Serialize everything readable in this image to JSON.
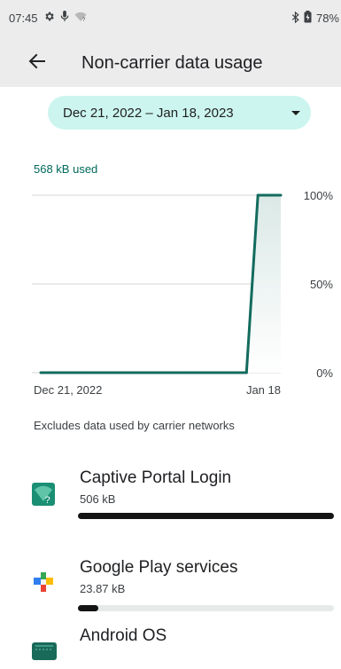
{
  "status_bar": {
    "time": "07:45",
    "battery": "78%",
    "icons": [
      "gear-icon",
      "mic-icon",
      "wifi-unknown-icon",
      "bluetooth-icon",
      "battery-charging-icon"
    ]
  },
  "app_bar": {
    "title": "Non-carrier data usage",
    "back_icon": "arrow-left-icon"
  },
  "date_range": {
    "label": "Dec 21, 2022 – Jan 18, 2023",
    "dropdown_icon": "caret-down-icon"
  },
  "usage": {
    "summary": "568 kB used"
  },
  "chart_data": {
    "type": "line",
    "x_start_label": "Dec 21, 2022",
    "x_end_label": "Jan 18",
    "y_ticks": [
      "100%",
      "50%",
      "0%"
    ],
    "ylim": [
      0,
      100
    ],
    "y_unit": "%",
    "series": [
      {
        "values": [
          0,
          0,
          0,
          0,
          0,
          0,
          0,
          0,
          0,
          0,
          0,
          0,
          0,
          0,
          0,
          0,
          0,
          0,
          0,
          100,
          100,
          100
        ]
      }
    ],
    "colors": {
      "line": "#126b5e",
      "fill": "#dbe9e6",
      "grid": "#d6d6d6"
    }
  },
  "note": "Excludes data used by carrier networks",
  "apps": [
    {
      "name": "Captive Portal Login",
      "size": "506 kB",
      "fraction": 1.0,
      "icon": "captive-portal-icon"
    },
    {
      "name": "Google Play services",
      "size": "23.87 kB",
      "fraction": 0.08,
      "icon": "play-services-icon"
    },
    {
      "name": "Android OS",
      "size": "",
      "fraction": 0,
      "icon": "android-os-icon"
    }
  ]
}
